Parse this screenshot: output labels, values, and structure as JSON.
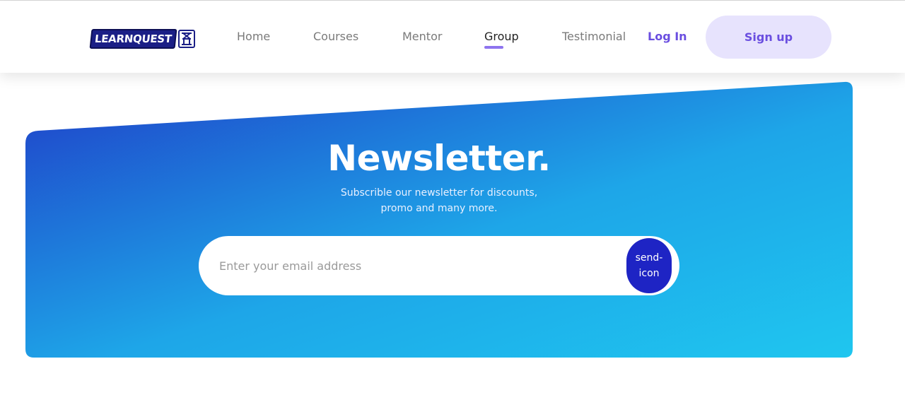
{
  "brand": {
    "logo_text": "LEARNQUEST",
    "logo_icon": "quest-logo-icon"
  },
  "nav": {
    "items": [
      {
        "label": "Home"
      },
      {
        "label": "Courses"
      },
      {
        "label": "Mentor"
      },
      {
        "label": "Group",
        "active": true
      },
      {
        "label": "Testimonial"
      }
    ],
    "login_label": "Log In",
    "signup_label": "Sign up"
  },
  "newsletter": {
    "title": "Newsletter.",
    "subtitle_line1": "Subscrible our newsletter for discounts,",
    "subtitle_line2": "promo and many more.",
    "email_placeholder": "Enter your email address",
    "email_value": "",
    "send_label": "send-icon"
  },
  "colors": {
    "accent": "#6a4ee0",
    "signup_bg": "#e7e3fd",
    "gradient_start": "#1f3ec8",
    "gradient_end": "#1fc0ee",
    "send_button": "#1e24c4"
  }
}
